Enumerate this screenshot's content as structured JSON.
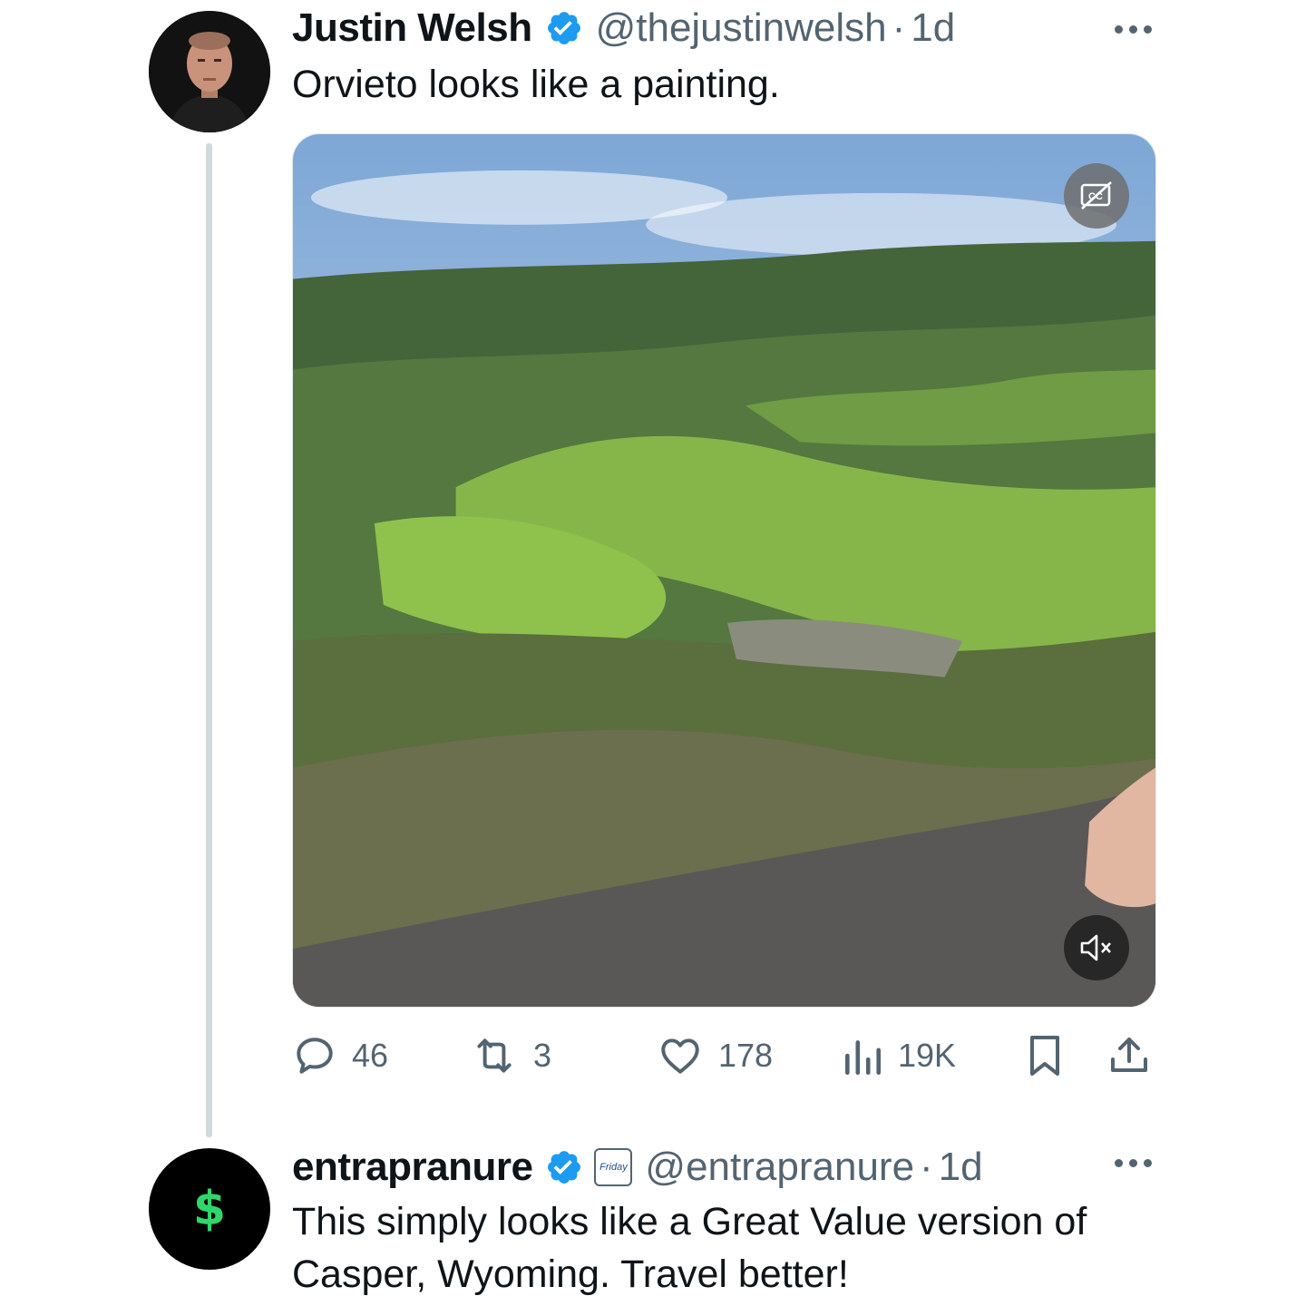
{
  "tweets": [
    {
      "name": "Justin Welsh",
      "handle": "@thejustinwelsh",
      "separator": "·",
      "time": "1d",
      "text": "Orvieto looks like a painting.",
      "stats": {
        "replies": "46",
        "reposts": "3",
        "likes": "178",
        "views": "19K"
      }
    },
    {
      "name": "entrapranure",
      "handle": "@entrapranure",
      "separator": "·",
      "time": "1d",
      "avatar_symbol": "$",
      "affiliate_badge": "Friday",
      "text": "This simply looks like a Great Value version of Casper, Wyoming.  Travel better!"
    }
  ],
  "icons": {
    "verified": "verified-badge-icon",
    "more": "more-dots-icon",
    "captions": "captions-off-icon",
    "mute": "muted-speaker-icon",
    "reply": "reply-icon",
    "repost": "repost-icon",
    "like": "heart-icon",
    "views": "views-chart-icon",
    "bookmark": "bookmark-icon",
    "share": "share-icon"
  },
  "colors": {
    "verified_blue": "#1d9bf0",
    "secondary_text": "#536471",
    "primary_text": "#0f1419",
    "thread_line": "#cfd9de",
    "money_green": "#2fd66a"
  }
}
